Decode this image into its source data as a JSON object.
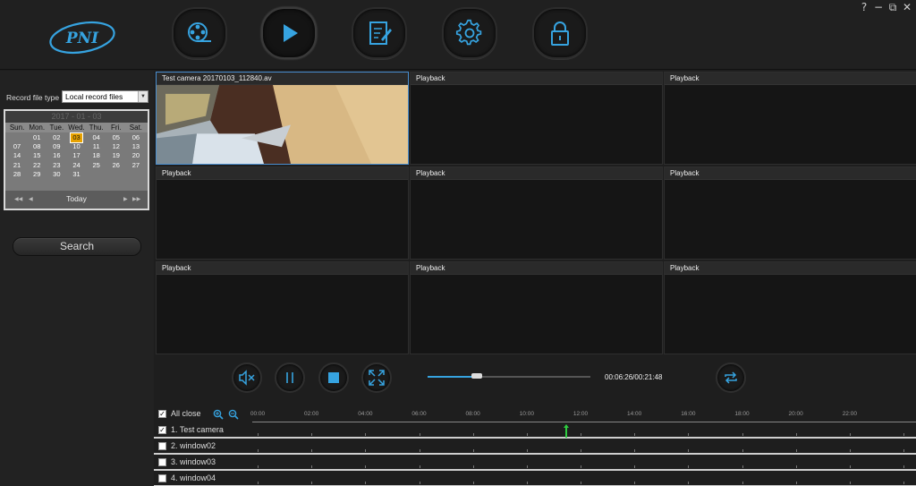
{
  "window_controls": {
    "help": "?",
    "minimize": "−",
    "restore": "⧉",
    "close": "✕"
  },
  "brand": {
    "logo_text": "PNI",
    "accent": "#36a3e0"
  },
  "toolbar": [
    {
      "name": "record-files-button",
      "icon": "film-reel-icon"
    },
    {
      "name": "playback-button",
      "icon": "play-icon"
    },
    {
      "name": "log-button",
      "icon": "edit-document-icon"
    },
    {
      "name": "settings-button",
      "icon": "gear-icon"
    },
    {
      "name": "lock-button",
      "icon": "lock-icon"
    }
  ],
  "left": {
    "record_file_type_label": "Record file type",
    "record_file_type_value": "Local record files",
    "calendar": {
      "month_title": "2017 - 01 - 03",
      "weekdays": [
        "Sun.",
        "Mon.",
        "Tue.",
        "Wed.",
        "Thu.",
        "Fri.",
        "Sat."
      ],
      "days": [
        "",
        "01",
        "02",
        "03",
        "04",
        "05",
        "06",
        "07",
        "08",
        "09",
        "10",
        "11",
        "12",
        "13",
        "14",
        "15",
        "16",
        "17",
        "18",
        "19",
        "20",
        "21",
        "22",
        "23",
        "24",
        "25",
        "26",
        "27",
        "28",
        "29",
        "30",
        "31"
      ],
      "selected_day": "03",
      "today_label": "Today"
    },
    "search_label": "Search"
  },
  "panes": [
    {
      "title": "Test camera   20170103_112840.av",
      "has_video": true
    },
    {
      "title": "Playback"
    },
    {
      "title": "Playback"
    },
    {
      "title": "Playback"
    },
    {
      "title": "Playback"
    },
    {
      "title": "Playback"
    },
    {
      "title": "Playback"
    },
    {
      "title": "Playback"
    },
    {
      "title": "Playback"
    }
  ],
  "controls": {
    "buttons": [
      {
        "name": "mute-button",
        "icon": "speaker-mute-icon"
      },
      {
        "name": "pause-button",
        "icon": "pause-icon"
      },
      {
        "name": "stop-button",
        "icon": "stop-icon"
      },
      {
        "name": "fullscreen-button",
        "icon": "expand-icon"
      },
      {
        "name": "loop-button",
        "icon": "repeat-icon"
      }
    ],
    "progress_fraction": 0.3,
    "time_readout": "00:06:26/00:21:48"
  },
  "timeline": {
    "all_close_label": "All close",
    "hours": [
      "00:00",
      "02:00",
      "04:00",
      "06:00",
      "08:00",
      "10:00",
      "12:00",
      "14:00",
      "16:00",
      "18:00",
      "20:00",
      "22:00"
    ],
    "rows": [
      {
        "label": "1. Test camera",
        "checked": true
      },
      {
        "label": "2. window02",
        "checked": false
      },
      {
        "label": "3. window03",
        "checked": false
      },
      {
        "label": "4. window04",
        "checked": false
      }
    ],
    "marker_time": "11:28"
  }
}
